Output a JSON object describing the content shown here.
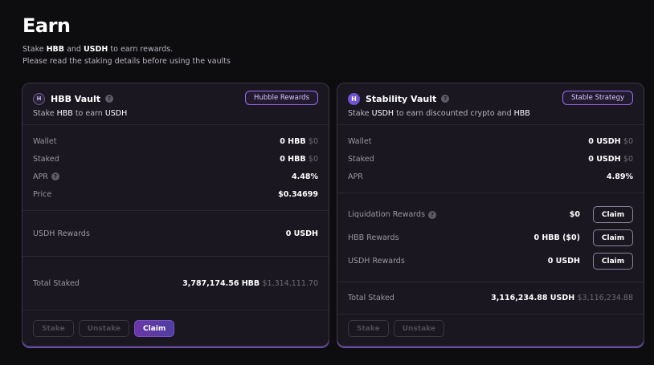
{
  "page": {
    "title": "Earn",
    "subtitle_pre": "Stake ",
    "subtitle_hbb": "HBB",
    "subtitle_and": " and ",
    "subtitle_usdh": "USDH",
    "subtitle_post": " to earn rewards.",
    "subtitle_line2": "Please read the staking details before using the vaults"
  },
  "hbb_vault": {
    "icon_text": "H",
    "name": "HBB Vault",
    "badge": "Hubble Rewards",
    "sub_pre": "Stake ",
    "sub_token": "HBB",
    "sub_mid": " to earn ",
    "sub_reward": "USDH",
    "stats": [
      {
        "label": "Wallet",
        "value": "0 HBB",
        "muted": "$0"
      },
      {
        "label": "Staked",
        "value": "0 HBB",
        "muted": "$0"
      },
      {
        "label": "APR",
        "value": "4.48%",
        "muted": ""
      },
      {
        "label": "Price",
        "value": "$0.34699",
        "muted": ""
      }
    ],
    "rewards_label": "USDH Rewards",
    "rewards_value": "0 USDH",
    "total_label": "Total Staked",
    "total_value": "3,787,174.56 HBB",
    "total_muted": "$1,314,111.70",
    "buttons": {
      "stake": "Stake",
      "unstake": "Unstake",
      "claim": "Claim"
    }
  },
  "stability_vault": {
    "icon_text": "H",
    "name": "Stability Vault",
    "badge": "Stable Strategy",
    "sub_pre": "Stake ",
    "sub_token": "USDH",
    "sub_mid": " to earn discounted crypto and ",
    "sub_reward": "HBB",
    "stats": [
      {
        "label": "Wallet",
        "value": "0 USDH",
        "muted": "$0"
      },
      {
        "label": "Staked",
        "value": "0 USDH",
        "muted": "$0"
      },
      {
        "label": "APR",
        "value": "4.89%",
        "muted": ""
      }
    ],
    "rewards": [
      {
        "label": "Liquidation Rewards",
        "value": "$0",
        "claim": "Claim"
      },
      {
        "label": "HBB Rewards",
        "value": "0 HBB ($0)",
        "claim": "Claim"
      },
      {
        "label": "USDH Rewards",
        "value": "0 USDH",
        "claim": "Claim"
      }
    ],
    "total_label": "Total Staked",
    "total_value": "3,116,234.88 USDH",
    "total_muted": "$3,116,234.88",
    "buttons": {
      "stake": "Stake",
      "unstake": "Unstake"
    }
  },
  "help_icon_glyph": "?",
  "colors": {
    "accent": "#9d6cf0",
    "background": "#0d0c0e",
    "card": "#1a1720"
  }
}
